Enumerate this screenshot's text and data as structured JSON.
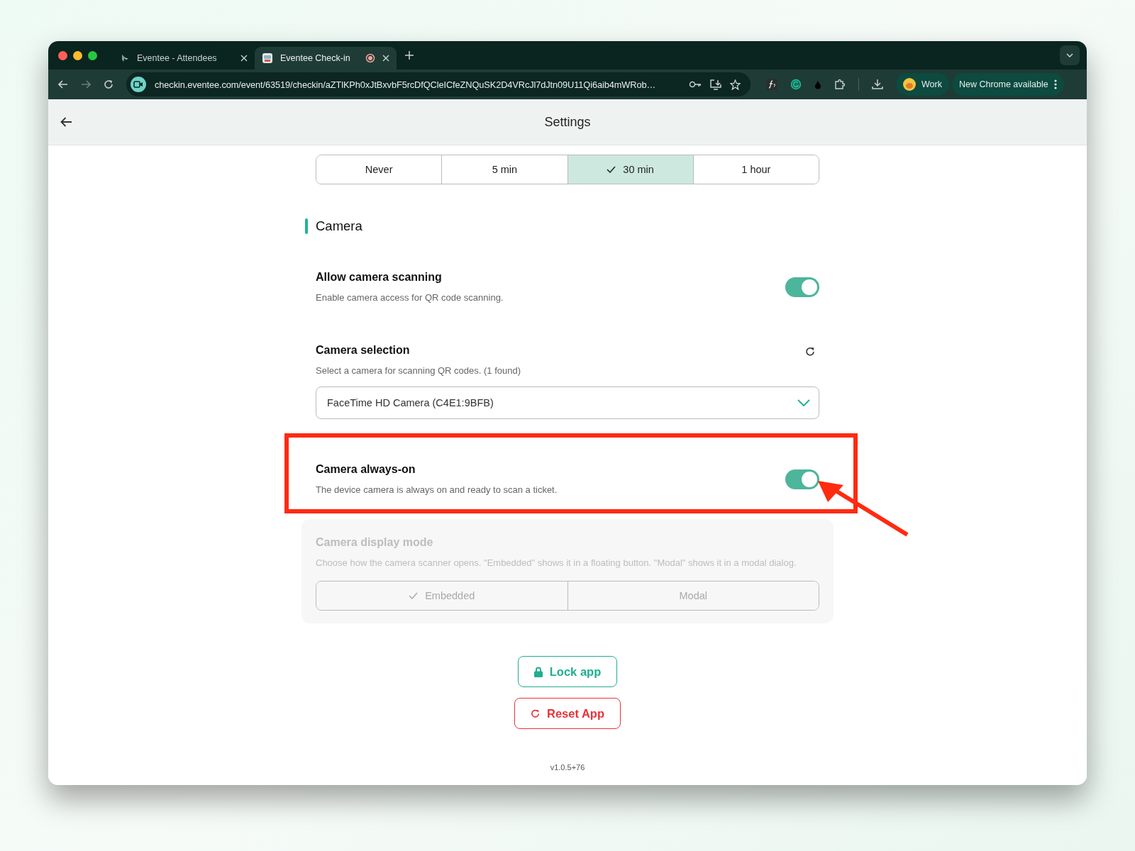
{
  "browser": {
    "tabs": [
      {
        "title": "Eventee - Attendees",
        "selected": false
      },
      {
        "title": "Eventee Check-in",
        "selected": true,
        "recording": true
      }
    ],
    "url": "checkin.eventee.com/event/63519/checkin/aZTlKPh0xJtBxvbF5rcDfQCleICfeZNQuSK2D4VRcJl7dJtn09U11Qi6aib4mWRob…",
    "profile": "Work",
    "update_notice": "New Chrome available"
  },
  "page": {
    "title": "Settings"
  },
  "timeout_options": [
    {
      "label": "Never",
      "selected": false
    },
    {
      "label": "5 min",
      "selected": false
    },
    {
      "label": "30 min",
      "selected": true
    },
    {
      "label": "1 hour",
      "selected": false
    }
  ],
  "section": {
    "title": "Camera"
  },
  "settings": [
    {
      "kind": "toggle",
      "title": "Allow camera scanning",
      "description": "Enable camera access for QR code scanning.",
      "on": true
    },
    {
      "kind": "select",
      "title": "Camera selection",
      "description": "Select a camera for scanning QR codes. (1 found)",
      "value": "FaceTime HD Camera (C4E1:9BFB)"
    },
    {
      "kind": "toggle",
      "title": "Camera always-on",
      "description": "The device camera is always on and ready to scan a ticket.",
      "on": true,
      "highlighted": true
    },
    {
      "kind": "segmented",
      "title": "Camera display mode",
      "description": "Choose how the camera scanner opens. \"Embedded\" shows it in a floating button. \"Modal\" shows it in a modal dialog.",
      "disabled": true,
      "options": [
        {
          "label": "Embedded",
          "selected": true
        },
        {
          "label": "Modal",
          "selected": false
        }
      ]
    }
  ],
  "buttons": [
    {
      "kind": "lock",
      "label": "Lock app"
    },
    {
      "kind": "reset",
      "label": "Reset App"
    }
  ],
  "version": "v1.0.5+76"
}
